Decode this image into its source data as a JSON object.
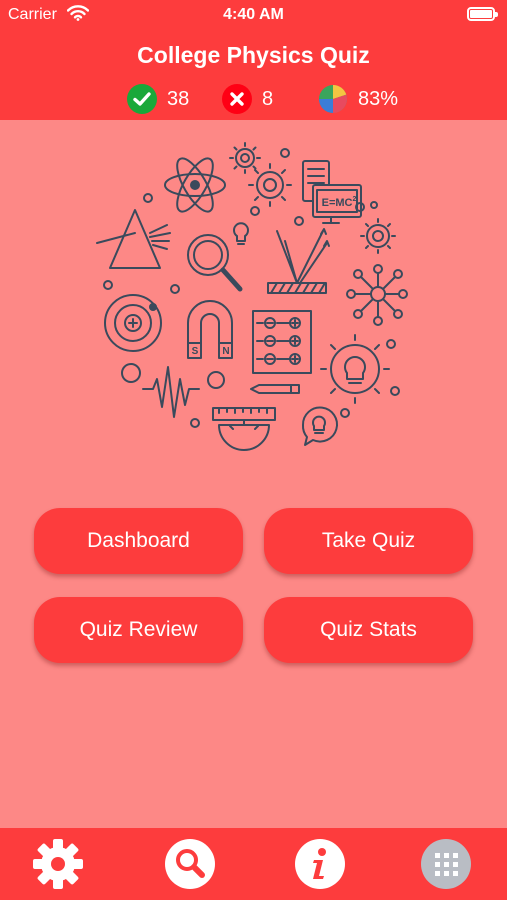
{
  "status_bar": {
    "carrier": "Carrier",
    "time": "4:40 AM",
    "battery_level": 1.0
  },
  "header": {
    "title": "College Physics Quiz"
  },
  "stats": {
    "correct": "38",
    "wrong": "8",
    "percent": "83%"
  },
  "artwork": {
    "equation": "E=MC",
    "equation_sup": "2",
    "magnet_south": "S",
    "magnet_north": "N"
  },
  "buttons": {
    "dashboard": "Dashboard",
    "take_quiz": "Take Quiz",
    "quiz_review": "Quiz Review",
    "quiz_stats": "Quiz Stats"
  },
  "tab_bar": {
    "icons": [
      "gear-icon",
      "search-icon",
      "info-icon",
      "grid-icon"
    ]
  },
  "colors": {
    "primary": "#fd3c3d",
    "background": "#fd8886",
    "correct": "#1aa83a",
    "wrong": "#ff0014",
    "line": "#3a4a5c"
  }
}
